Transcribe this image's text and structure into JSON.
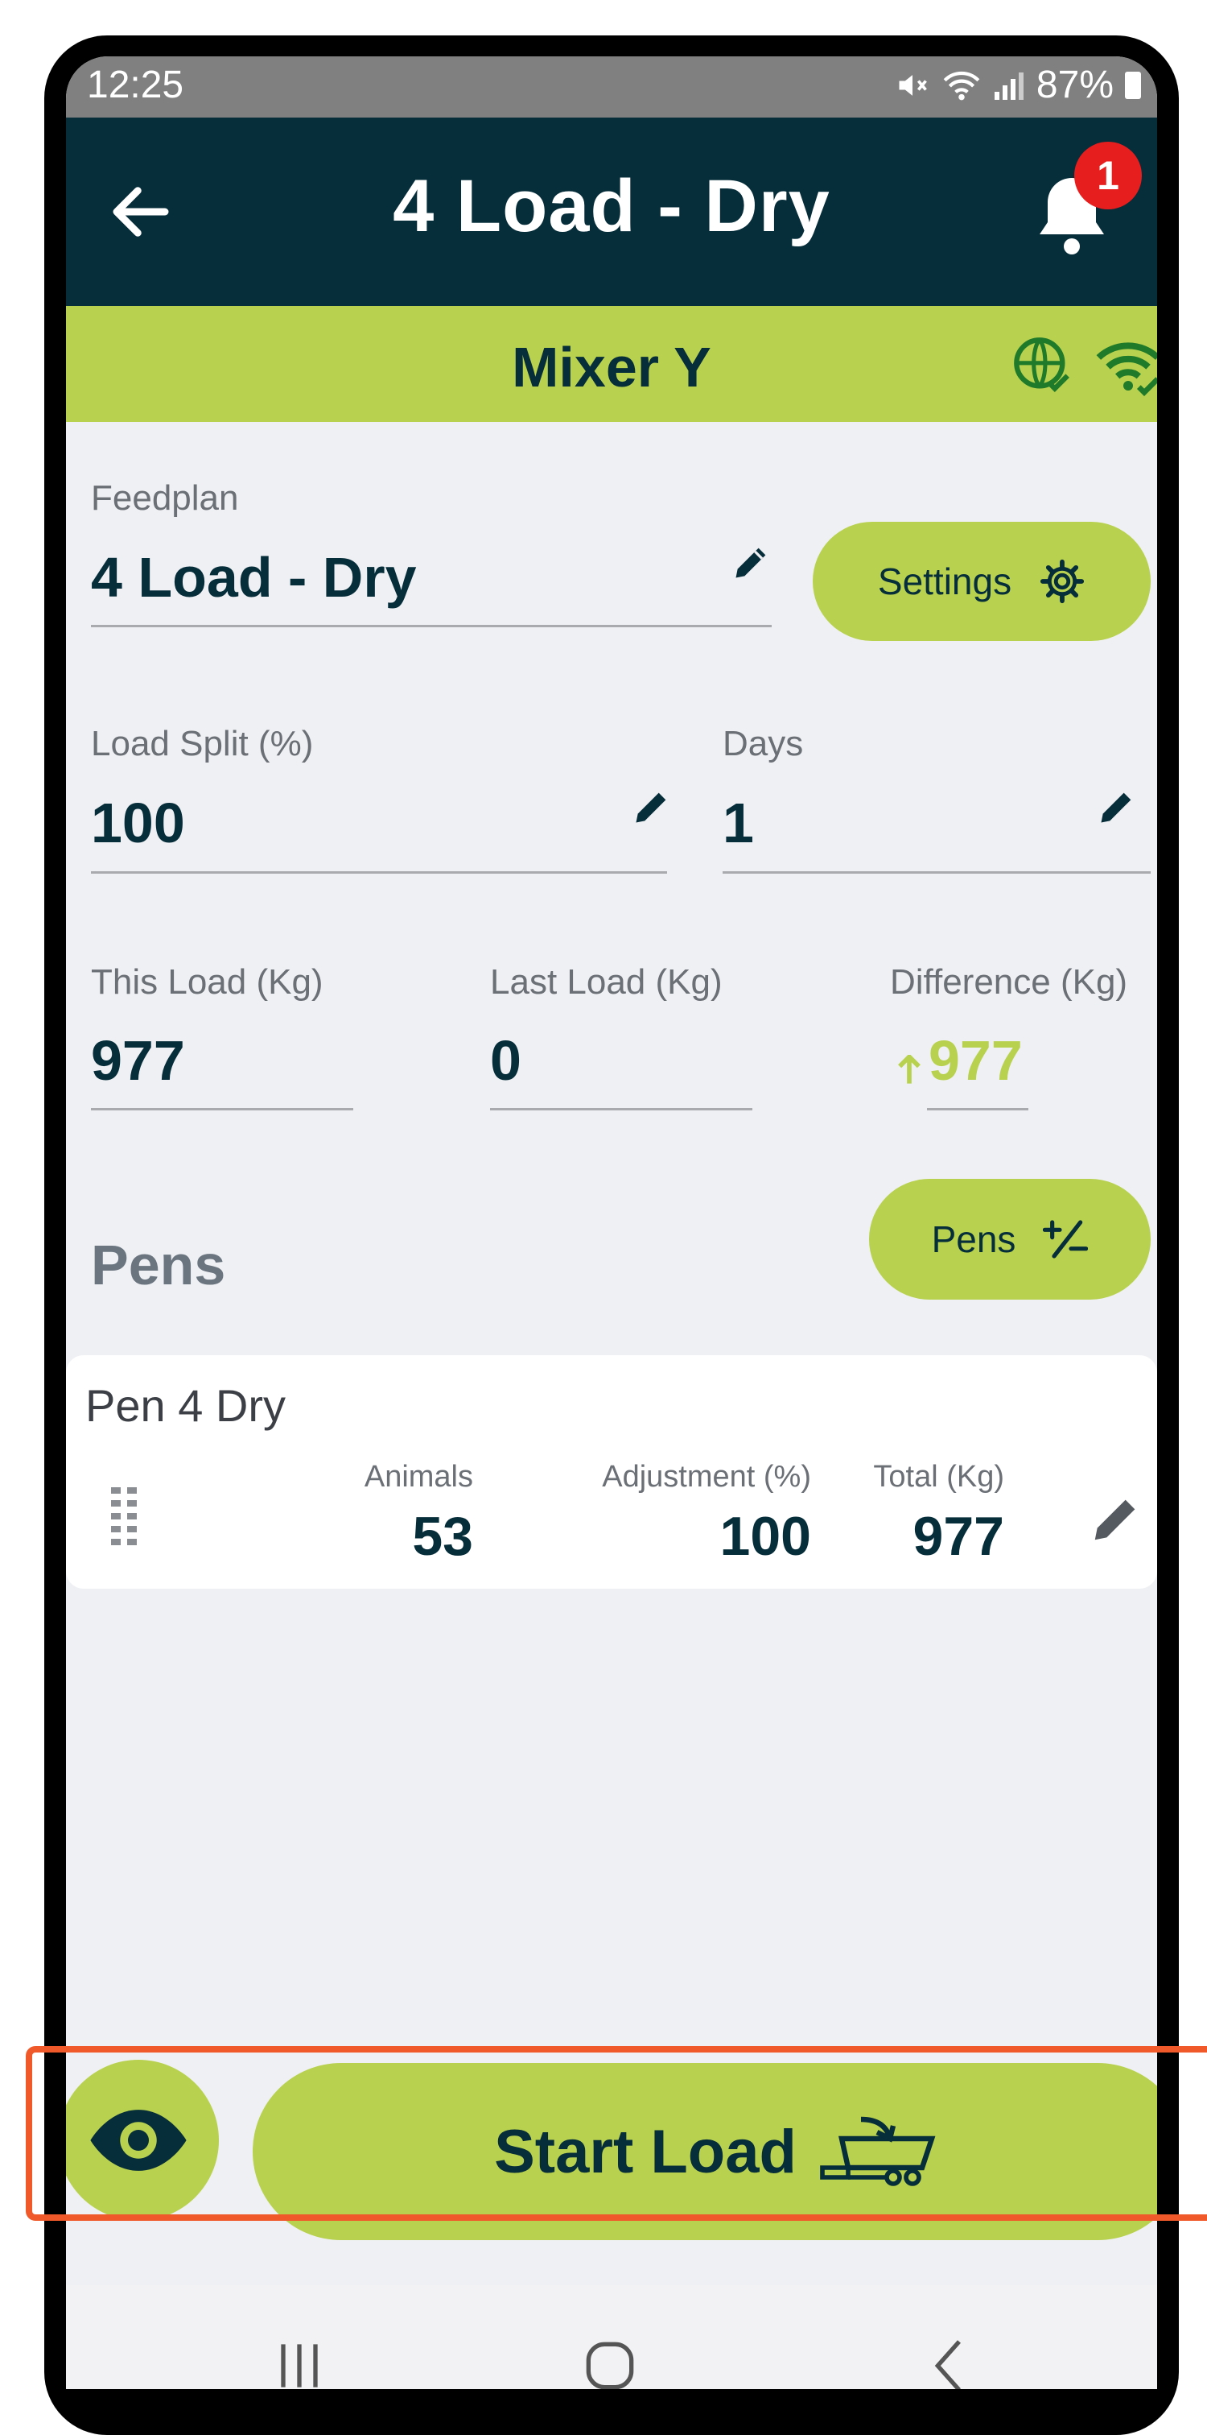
{
  "status_bar": {
    "time": "12:25",
    "battery": "87%"
  },
  "app_bar": {
    "title": "4 Load - Dry",
    "notification_count": "1"
  },
  "mixer_bar": {
    "name": "Mixer Y"
  },
  "feedplan": {
    "label": "Feedplan",
    "value": "4 Load - Dry"
  },
  "settings_button": {
    "label": "Settings"
  },
  "load_split": {
    "label": "Load Split (%)",
    "value": "100"
  },
  "days": {
    "label": "Days",
    "value": "1"
  },
  "this_load": {
    "label": "This Load (Kg)",
    "value": "977"
  },
  "last_load": {
    "label": "Last Load (Kg)",
    "value": "0"
  },
  "difference": {
    "label": "Difference (Kg)",
    "value": "977"
  },
  "pens_section": {
    "title": "Pens",
    "button_label": "Pens"
  },
  "pen_card": {
    "name": "Pen 4 Dry",
    "animals_label": "Animals",
    "animals_value": "53",
    "adjustment_label": "Adjustment (%)",
    "adjustment_value": "100",
    "total_label": "Total (Kg)",
    "total_value": "977"
  },
  "start_button": {
    "label": "Start Load"
  },
  "colors": {
    "navy": "#062d3a",
    "lime": "#b8d14e",
    "highlight": "#f05a2a",
    "badge": "#e61e1e"
  },
  "icons": [
    "back-arrow-icon",
    "bell-icon",
    "globe-check-icon",
    "wifi-check-icon",
    "pencil-icon",
    "gear-icon",
    "plus-minus-icon",
    "drag-handle-icon",
    "eye-icon",
    "mixer-truck-icon",
    "recents-icon",
    "home-icon",
    "nav-back-icon"
  ]
}
